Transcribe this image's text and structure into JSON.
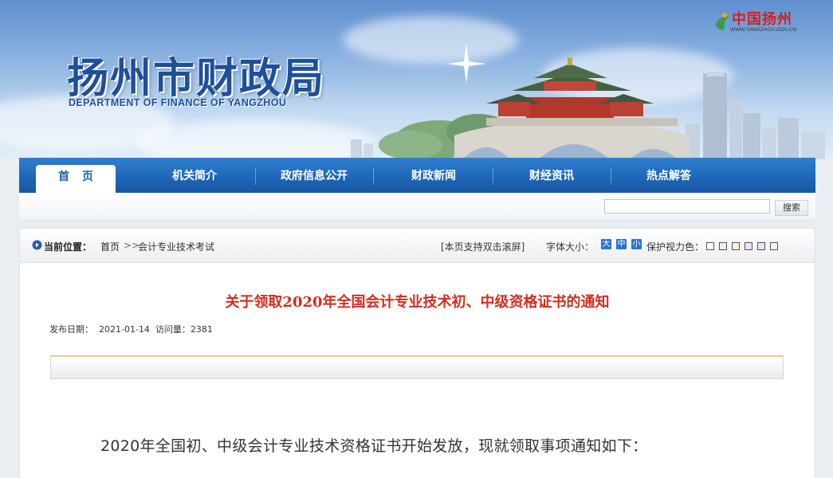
{
  "header": {
    "title": "扬州市财政局",
    "subtitle": "DEPARTMENT OF FINANCE OF YANGZHOU",
    "portal_name": "中国扬州",
    "portal_url": "WWW.YANGZHOU.GOV.CN"
  },
  "nav": {
    "items": [
      {
        "label": "首页",
        "active": true
      },
      {
        "label": "机关简介"
      },
      {
        "label": "政府信息公开"
      },
      {
        "label": "财政新闻"
      },
      {
        "label": "财经资讯"
      },
      {
        "label": "热点解答"
      }
    ]
  },
  "search": {
    "value": "",
    "button_label": "搜索"
  },
  "location": {
    "label": "当前位置：",
    "home": "首页",
    "separator": ">>",
    "current": "会计专业技术考试",
    "scroll_tip": "[本页支持双击滚屏]",
    "font_size_label": "字体大小：",
    "font_sizes": [
      "大",
      "中",
      "小"
    ],
    "eye_protect_label": "保护视力色：",
    "eye_colors": [
      "#ffffff",
      "#e3f3f7",
      "#f5f5d5",
      "#efe0f3",
      "#dfe8f7",
      "#f5f5f5"
    ]
  },
  "article": {
    "title": "关于领取2020年全国会计专业技术初、中级资格证书的通知",
    "publish_label": "发布日期：",
    "publish_date": "2021-01-14",
    "views_label": "访问量：",
    "views": "2381",
    "lead": "2020年全国初、中级会计专业技术资格证书开始发放，现就领取事项通知如下："
  },
  "colors": {
    "brand_blue": "#1f67b8",
    "title_red": "#d02d20"
  }
}
